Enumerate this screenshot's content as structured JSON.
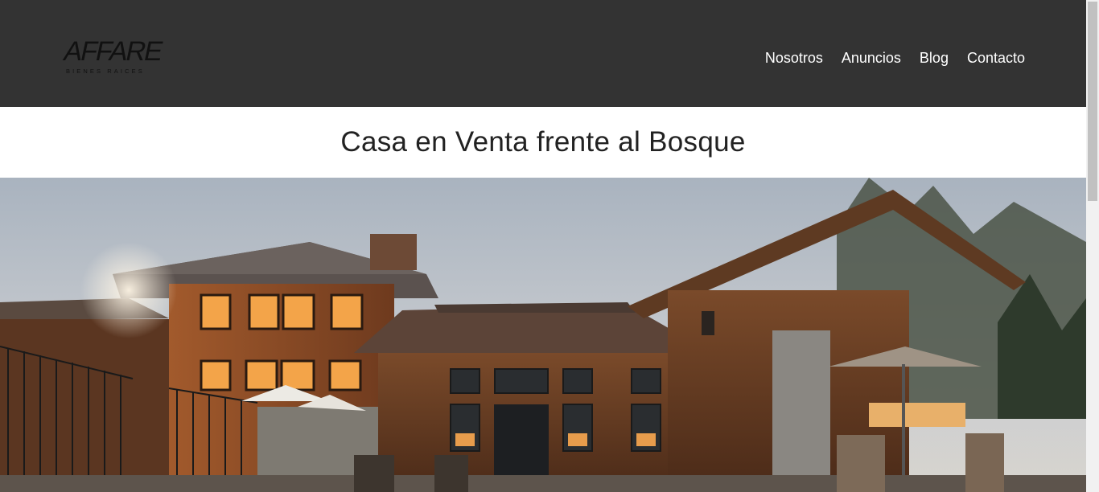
{
  "header": {
    "logo": {
      "wordmark": "AFFARE",
      "tagline": "BIENES RAICES",
      "accent_color": "#7b2e7b"
    },
    "nav": [
      "Nosotros",
      "Anuncios",
      "Blog",
      "Contacto"
    ],
    "background": "#333333"
  },
  "main": {
    "title": "Casa en Venta frente al Bosque",
    "hero_image": "house-exterior-photo"
  }
}
